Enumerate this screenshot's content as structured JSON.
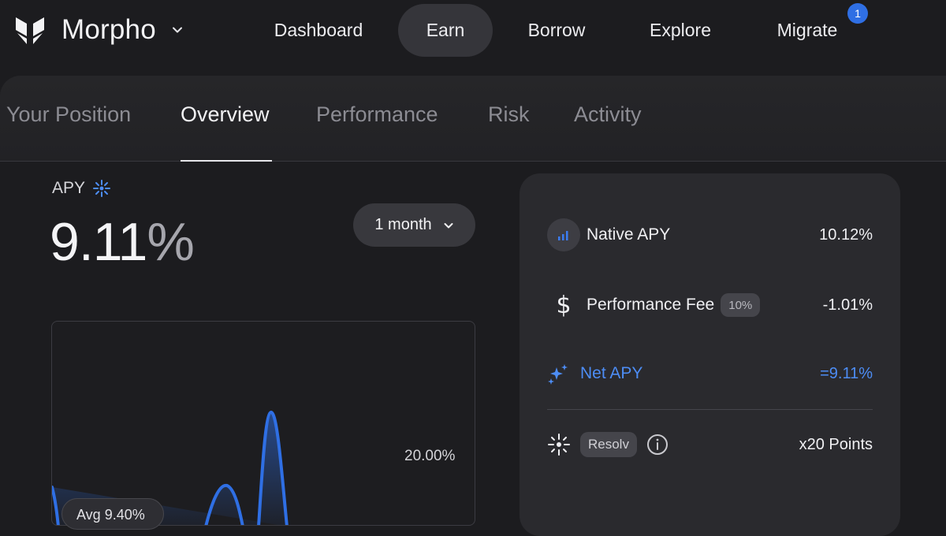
{
  "nav": {
    "brand": "Morpho",
    "items": [
      {
        "label": "Dashboard",
        "active": false
      },
      {
        "label": "Earn",
        "active": true
      },
      {
        "label": "Borrow",
        "active": false
      },
      {
        "label": "Explore",
        "active": false
      },
      {
        "label": "Migrate",
        "active": false
      }
    ],
    "migrate_badge": "1",
    "accent_color": "#2f6fe4"
  },
  "tabs": [
    {
      "label": "Your Position",
      "active": false
    },
    {
      "label": "Overview",
      "active": true
    },
    {
      "label": "Performance",
      "active": false
    },
    {
      "label": "Risk",
      "active": false
    },
    {
      "label": "Activity",
      "active": false
    }
  ],
  "apy": {
    "label": "APY",
    "value": "9.11",
    "unit": "%",
    "period": "1 month"
  },
  "chart": {
    "y_tick": "20.00%",
    "avg_pill": "Avg 9.40%",
    "line_color": "#2f6fe4"
  },
  "breakdown": {
    "native": {
      "label": "Native APY",
      "value": "10.12%"
    },
    "fee": {
      "label": "Performance Fee",
      "chip": "10%",
      "value": "-1.01%"
    },
    "net": {
      "label": "Net APY",
      "value": "=9.11%"
    },
    "points": {
      "chip": "Resolv",
      "value": "x20 Points"
    }
  }
}
